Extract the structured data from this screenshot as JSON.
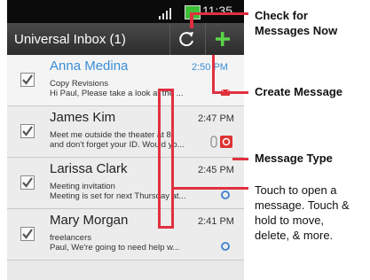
{
  "status": {
    "time": "11:35"
  },
  "header": {
    "title": "Universal Inbox (1)"
  },
  "messages": [
    {
      "name": "Anna Medina",
      "time": "2:50 PM",
      "line1": "Copy Revisions",
      "line2": "Hi Paul, Please take a look at the ...",
      "unread": true,
      "type_icon": "email-icon"
    },
    {
      "name": "James Kim",
      "time": "2:47 PM",
      "line1": "Meet me outside the theater at 8",
      "line2": "and don't forget your ID. Would yo...",
      "unread": false,
      "type_icon": "message-icon"
    },
    {
      "name": "Larissa Clark",
      "time": "2:45 PM",
      "line1": "Meeting invitation",
      "line2": "Meeting is set for next Thursday at...",
      "unread": false,
      "type_icon": "sync-icon"
    },
    {
      "name": "Mary Morgan",
      "time": "2:41 PM",
      "line1": "freelancers",
      "line2": "Paul, We're going to need help w...",
      "unread": false,
      "type_icon": "sync-icon"
    }
  ],
  "callouts": {
    "check": "Check for\nMessages Now",
    "create": "Create Message",
    "type": "Message Type",
    "touch": "Touch to open a\nmessage. Touch &\nhold to move,\ndelete, & more."
  },
  "colors": {
    "accent": "#3a8ed6",
    "callout": "#e03040",
    "plus": "#5bd54a"
  }
}
